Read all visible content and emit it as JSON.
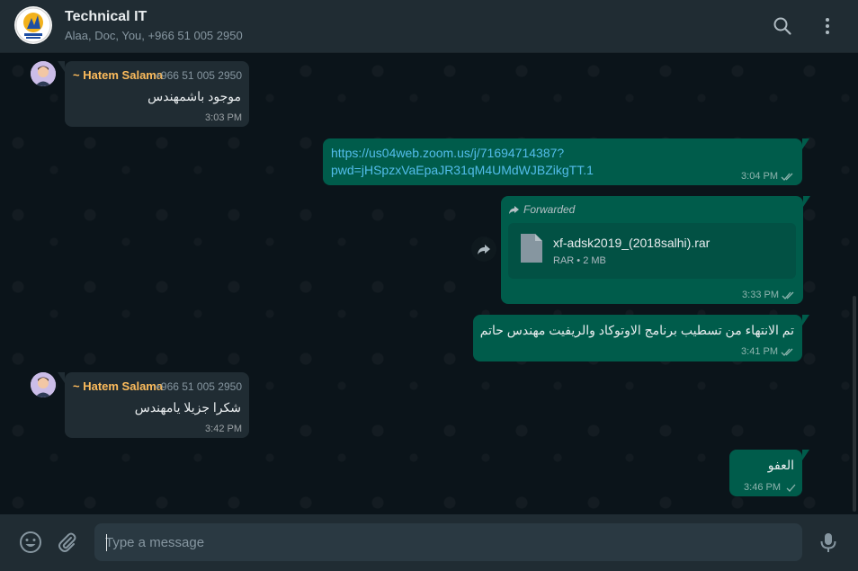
{
  "header": {
    "title": "Technical IT",
    "members": "Alaa, Doc, You, +966 51 005 2950"
  },
  "colors": {
    "header_bg": "#202c33",
    "chat_bg": "#0b141a",
    "incoming": "#202c33",
    "outgoing": "#005c4b",
    "sender_name": "#fdbc5c",
    "link": "#53bdeb"
  },
  "messages": [
    {
      "direction": "in",
      "sender": "~ Hatem Salama",
      "phone": "+966 51 005 2950",
      "text": "موجود باشمهندس",
      "time": "3:03 PM"
    },
    {
      "direction": "out",
      "link_line1": "https://us04web.zoom.us/j/71694714387?",
      "link_line2": "pwd=jHSpzxVaEpaJR31qM4UMdWJBZikgTT.1",
      "time": "3:04 PM",
      "status": "read"
    },
    {
      "direction": "out",
      "forwarded_label": "Forwarded",
      "file_name": "xf-adsk2019_(2018salhi).rar",
      "file_meta": "RAR • 2 MB",
      "time": "3:33 PM",
      "status": "read"
    },
    {
      "direction": "out",
      "text": "تم الانتهاء من تسطيب برنامج الاوتوكاد والريفيت مهندس حاتم",
      "time": "3:41 PM",
      "status": "read"
    },
    {
      "direction": "in",
      "sender": "~ Hatem Salama",
      "phone": "+966 51 005 2950",
      "text": "شكرا جزيلا يامهندس",
      "time": "3:42 PM"
    },
    {
      "direction": "out",
      "text": "العفو",
      "time": "3:46 PM",
      "status": "sent"
    }
  ],
  "composer": {
    "placeholder": "Type a message"
  }
}
